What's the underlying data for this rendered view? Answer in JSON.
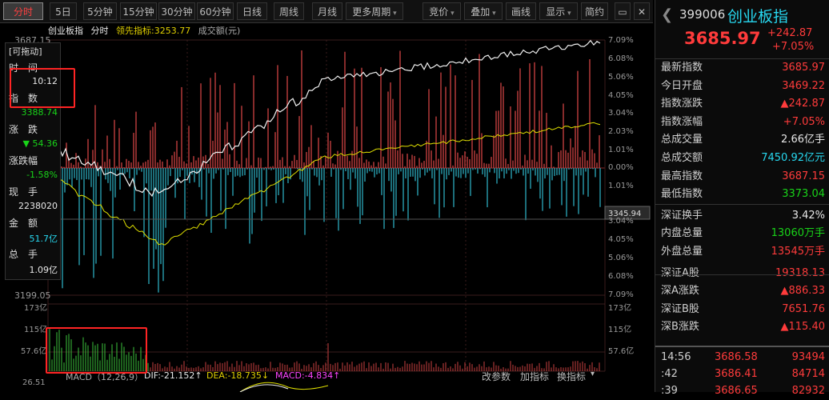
{
  "toolbar": {
    "periods": [
      "分时",
      "5日",
      "5分钟",
      "15分钟",
      "30分钟",
      "60分钟",
      "日线",
      "周线",
      "月线",
      "更多周期"
    ],
    "active": "分时",
    "options": [
      "竞价",
      "叠加",
      "画线",
      "显示",
      "简约"
    ]
  },
  "chart_header": {
    "name": "创业板指",
    "mode": "分时",
    "leading_label": "领先指标:",
    "leading_value": "3253.77",
    "volume_label": "成交额(元)"
  },
  "left_panel": {
    "drag": "[可拖动]",
    "time_label": "时　间",
    "time_value": "10:12",
    "index_label": "指　数",
    "index_value": "3388.74",
    "change_label": "涨　跌",
    "change_value": "▼ 54.36",
    "pct_label": "涨跌幅",
    "pct_value": "-1.58%",
    "hand_label": "现　手",
    "hand_value": "2238020",
    "amount_label": "金　额",
    "amount_value": "51.7亿",
    "total_label": "总　手",
    "total_value": "1.09亿"
  },
  "price_axis": {
    "top_left": "3687.15",
    "bottom_left": "3199.05",
    "cursor": "3345.94",
    "right_ticks_up": [
      "7.09%",
      "6.08%",
      "5.06%",
      "4.05%",
      "3.04%",
      "2.03%",
      "1.01%",
      "0.00%"
    ],
    "right_ticks_down": [
      "1.01%",
      "2.03%",
      "3.04%",
      "4.05%",
      "5.06%",
      "6.08%",
      "7.09%"
    ]
  },
  "volume_axis": {
    "left": [
      "173亿",
      "115亿",
      "57.6亿",
      "26.51"
    ],
    "right": [
      "173亿",
      "115亿",
      "57.6亿"
    ]
  },
  "macd": {
    "label": "MACD（12,26,9）",
    "dif": "DIF:-21.152↑",
    "dea": "DEA:-18.735↓",
    "macd": "MACD:-4.834↑",
    "params": "改参数",
    "add": "加指标",
    "switch": "换指标"
  },
  "quote": {
    "code": "399006",
    "name": "创业板指",
    "price": "3685.97",
    "change": "+242.87",
    "pct": "+7.05%"
  },
  "stats": [
    {
      "k": "最新指数",
      "v": "3685.97",
      "c": "red"
    },
    {
      "k": "今日开盘",
      "v": "3469.22",
      "c": "red"
    },
    {
      "k": "指数涨跌",
      "v": "▲242.87",
      "c": "red"
    },
    {
      "k": "指数涨幅",
      "v": "+7.05%",
      "c": "red"
    },
    {
      "k": "总成交量",
      "v": "2.66亿手",
      "c": "white"
    },
    {
      "k": "总成交额",
      "v": "7450.92亿元",
      "c": "cyan"
    },
    {
      "k": "最高指数",
      "v": "3687.15",
      "c": "red"
    },
    {
      "k": "最低指数",
      "v": "3373.04",
      "c": "green"
    },
    {
      "k": "深证换手",
      "v": "3.42%",
      "c": "white"
    },
    {
      "k": "内盘总量",
      "v": "13060万手",
      "c": "green"
    },
    {
      "k": "外盘总量",
      "v": "13545万手",
      "c": "red"
    },
    {
      "k": "深证A股",
      "v": "19318.13",
      "c": "red"
    },
    {
      "k": "深A涨跌",
      "v": "▲886.33",
      "c": "red"
    },
    {
      "k": "深证B股",
      "v": "7651.76",
      "c": "red"
    },
    {
      "k": "深B涨跌",
      "v": "▲115.40",
      "c": "red"
    }
  ],
  "ticks": [
    {
      "t": "14:56",
      "p": "3686.58",
      "v": "93494"
    },
    {
      "t": ":42",
      "p": "3686.41",
      "v": "84714"
    },
    {
      "t": ":39",
      "p": "3686.65",
      "v": "82932"
    }
  ],
  "colors": {
    "up": "#ff3b3b",
    "down": "#19d419",
    "accent": "#27d8f0"
  }
}
